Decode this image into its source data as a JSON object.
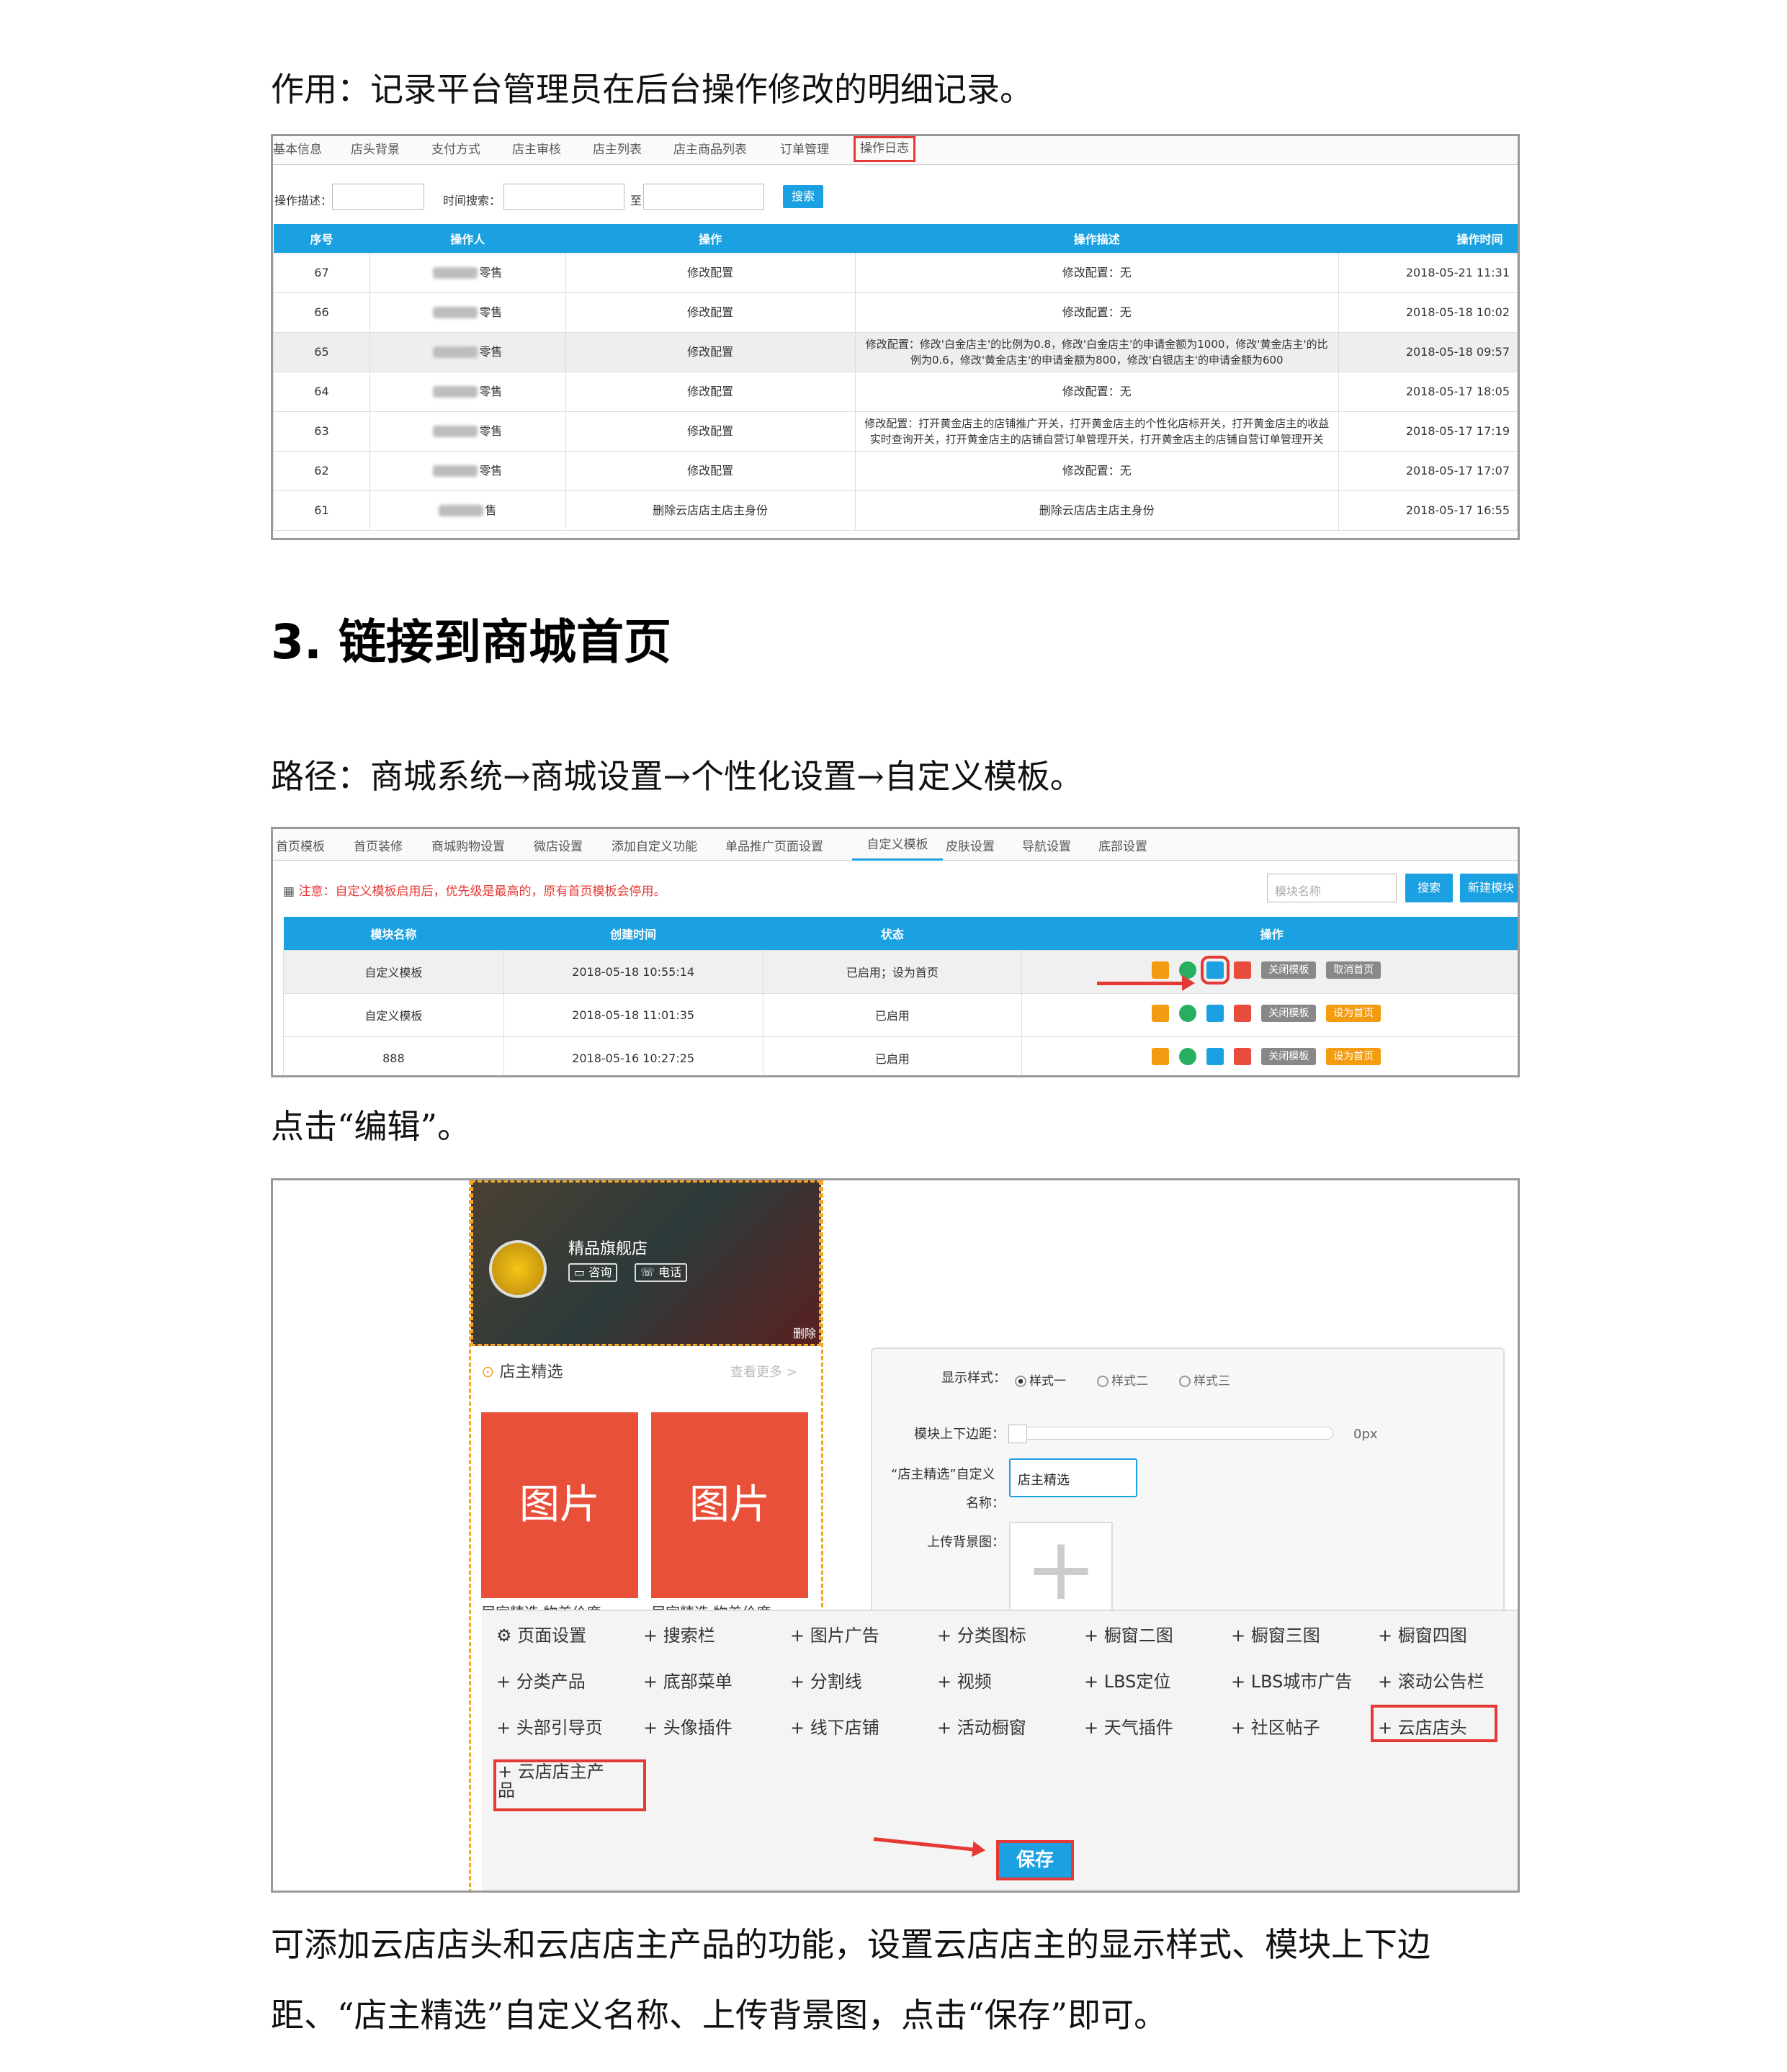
{
  "intro": "作用：记录平台管理员在后台操作修改的明细记录。",
  "log_screen": {
    "tabs": [
      "基本信息",
      "店头背景",
      "支付方式",
      "店主审核",
      "店主列表",
      "店主商品列表",
      "订单管理",
      "操作日志"
    ],
    "search": {
      "desc_label": "操作描述：",
      "time_label": "时间搜索：",
      "to": "至",
      "button": "搜索"
    },
    "columns": [
      "序号",
      "操作人",
      "操作",
      "操作描述",
      "操作时间"
    ],
    "rows": [
      {
        "id": "67",
        "user": "零售",
        "op": "修改配置",
        "desc": "修改配置：无",
        "time": "2018-05-21 11:31"
      },
      {
        "id": "66",
        "user": "零售",
        "op": "修改配置",
        "desc": "修改配置：无",
        "time": "2018-05-18 10:02"
      },
      {
        "id": "65",
        "user": "零售",
        "op": "修改配置",
        "desc": "修改配置：修改'白金店主'的比例为0.8，修改'白金店主'的申请金额为1000，修改'黄金店主'的比例为0.6，修改'黄金店主'的申请金额为800，修改'白银店主'的申请金额为600",
        "time": "2018-05-18 09:57"
      },
      {
        "id": "64",
        "user": "零售",
        "op": "修改配置",
        "desc": "修改配置：无",
        "time": "2018-05-17 18:05"
      },
      {
        "id": "63",
        "user": "零售",
        "op": "修改配置",
        "desc": "修改配置：打开黄金店主的店铺推广开关，打开黄金店主的个性化店标开关，打开黄金店主的收益实时查询开关，打开黄金店主的店铺自营订单管理开关，打开黄金店主的店铺自营订单管理开关",
        "time": "2018-05-17 17:19"
      },
      {
        "id": "62",
        "user": "零售",
        "op": "修改配置",
        "desc": "修改配置：无",
        "time": "2018-05-17 17:07"
      },
      {
        "id": "61",
        "user": "售",
        "op": "删除云店店主店主身份",
        "desc": "删除云店店主店主身份",
        "time": "2018-05-17 16:55"
      }
    ]
  },
  "section_title": "3. 链接到商城首页",
  "path_text": "路径：商城系统→商城设置→个性化设置→自定义模板。",
  "template_screen": {
    "tabs": [
      "首页模板",
      "首页装修",
      "商城购物设置",
      "微店设置",
      "添加自定义功能",
      "单品推广页面设置",
      "自定义模板",
      "皮肤设置",
      "导航设置",
      "底部设置"
    ],
    "notice": "注意：自定义模板启用后，优先级是最高的，原有首页模板会停用。",
    "search_placeholder": "模块名称",
    "search_button": "搜索",
    "new_button": "新建模块",
    "columns": [
      "模块名称",
      "创建时间",
      "状态",
      "操作"
    ],
    "rows": [
      {
        "name": "自定义模板",
        "created": "2018-05-18 10:55:14",
        "status": "已启用；设为首页",
        "btn1": "关闭模板",
        "btn2": "取消首页"
      },
      {
        "name": "自定义模板",
        "created": "2018-05-18 11:01:35",
        "status": "已启用",
        "btn1": "关闭模板",
        "btn2": "设为首页"
      },
      {
        "name": "888",
        "created": "2018-05-16 10:27:25",
        "status": "已启用",
        "btn1": "关闭模板",
        "btn2": "设为首页"
      }
    ]
  },
  "click_edit": "点击“编辑”。",
  "editor_screen": {
    "shop_name": "精品旗舰店",
    "consult": "咨询",
    "phone": "电话",
    "delete": "删除",
    "section_label": "店主精选",
    "more": "查看更多 >",
    "tile_text": "图片",
    "tile_caption": "居家精选 物美价廉",
    "style_label": "显示样式：",
    "styles": [
      "样式一",
      "样式二",
      "样式三"
    ],
    "margin_label": "模块上下边距：",
    "margin_value": "0px",
    "name_label_1": "“店主精选”自定义",
    "name_label_2": "名称：",
    "name_value": "店主精选",
    "bg_label": "上传背景图：",
    "widgets": [
      [
        "页面设置",
        "+ 搜索栏",
        "+ 图片广告",
        "+ 分类图标",
        "+ 橱窗二图",
        "+ 橱窗三图",
        "+ 橱窗四图"
      ],
      [
        "+ 分类产品",
        "+ 底部菜单",
        "+ 分割线",
        "+ 视频",
        "+ LBS定位",
        "+ LBS城市广告",
        "+ 滚动公告栏"
      ],
      [
        "+ 头部引导页",
        "+ 头像插件",
        "+ 线下店铺",
        "+ 活动橱窗",
        "+ 天气插件",
        "+ 社区帖子",
        "+ 云店店头"
      ]
    ],
    "extra_widget_1": "+ 云店店主产",
    "extra_widget_2": "品",
    "save": "保存"
  },
  "summary_1": "可添加云店店头和云店店主产品的功能，设置云店店主的显示样式、模块上下边",
  "summary_2": "距、“店主精选”自定义名称、上传背景图，点击“保存”即可。",
  "colors": {
    "accent": "#1ba1e2",
    "highlight": "#e53935",
    "tile": "#e8503a"
  }
}
